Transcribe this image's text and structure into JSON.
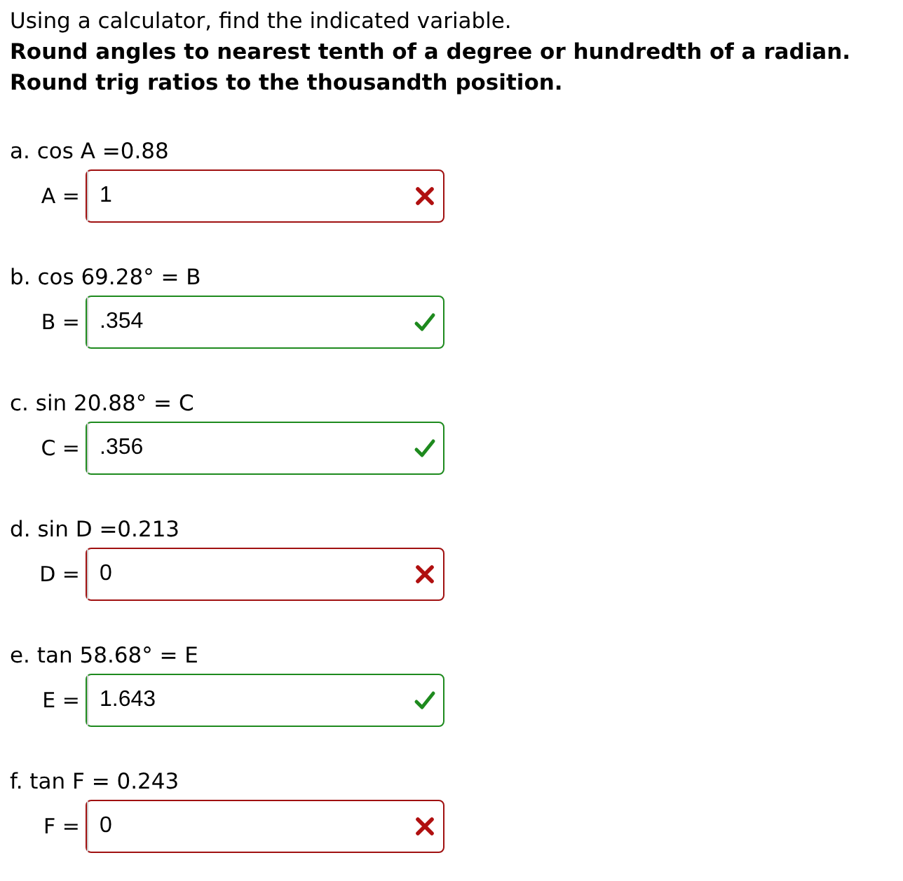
{
  "instructions": [
    {
      "text": "Using a calculator, find the indicated variable.",
      "bold": false
    },
    {
      "text": "Round angles to nearest tenth of a degree or hundredth of a radian.",
      "bold": true
    },
    {
      "text": "Round trig ratios to the thousandth position.",
      "bold": true
    }
  ],
  "problems": [
    {
      "prompt": "a. cos A =0.88",
      "variable": "A =",
      "answer": "1",
      "correct": false
    },
    {
      "prompt": "b. cos 69.28° = B",
      "variable": "B =",
      "answer": ".354",
      "correct": true
    },
    {
      "prompt": "c. sin 20.88° = C",
      "variable": "C =",
      "answer": ".356",
      "correct": true
    },
    {
      "prompt": "d. sin D =0.213",
      "variable": "D =",
      "answer": "0",
      "correct": false
    },
    {
      "prompt": "e. tan 58.68° = E",
      "variable": "E =",
      "answer": "1.643",
      "correct": true
    },
    {
      "prompt": "f. tan F = 0.243",
      "variable": "F =",
      "answer": "0",
      "correct": false
    }
  ]
}
